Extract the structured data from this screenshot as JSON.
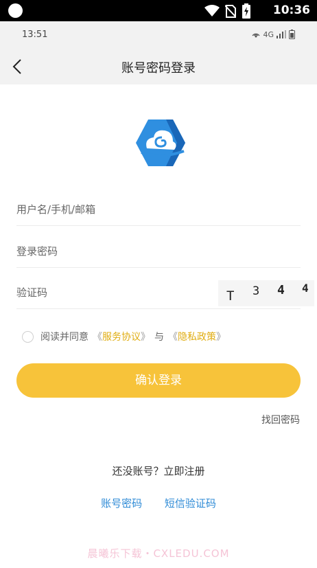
{
  "status_bar": {
    "time": "10:36",
    "icons": [
      "wifi-icon",
      "no-sim-icon",
      "battery-charging-icon"
    ]
  },
  "inner_status": {
    "time": "13:51",
    "network": "4G",
    "icons": [
      "hotspot-icon",
      "signal-icon",
      "battery-icon"
    ]
  },
  "nav": {
    "back_icon": "chevron-left-icon",
    "title": "账号密码登录"
  },
  "logo": {
    "icon": "cloud-hexagon-logo",
    "colors": {
      "primary": "#2f8fe0",
      "dark": "#1a67b8"
    }
  },
  "form": {
    "username_placeholder": "用户名/手机/邮箱",
    "password_placeholder": "登录密码",
    "captcha_placeholder": "验证码",
    "captcha_chars": [
      "T",
      "3",
      "4",
      "4"
    ]
  },
  "agreement": {
    "prefix": "阅读并同意",
    "open_bracket": "《",
    "close_bracket": "》",
    "service_link": "服务协议",
    "and": "与",
    "privacy_link": "隐私政策",
    "checked": false
  },
  "login_button": {
    "label": "确认登录",
    "color": "#f7c33a"
  },
  "forgot_password": "找回密码",
  "register_prompt": "还没账号？立即注册",
  "login_modes": [
    "账号密码",
    "短信验证码"
  ],
  "link_color": "#2d8ad6",
  "watermark": "晨曦乐下载・CXLEDU.COM"
}
